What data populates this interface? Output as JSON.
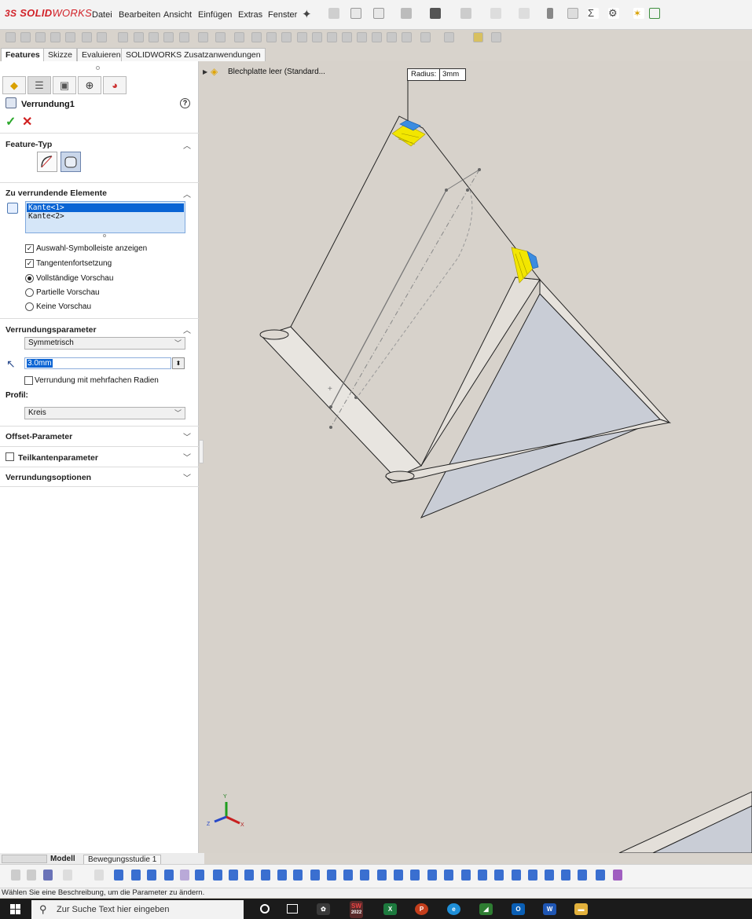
{
  "app": {
    "logo_main": "SOLID",
    "logo_thin": "WORKS",
    "logo_prefix": "3S"
  },
  "menu": [
    "Datei",
    "Bearbeiten",
    "Ansicht",
    "Einfügen",
    "Extras",
    "Fenster"
  ],
  "command_tabs": [
    "Features",
    "Skizze",
    "Evaluieren",
    "SOLIDWORKS Zusatzanwendungen"
  ],
  "property_manager": {
    "title": "Verrundung1",
    "help": "?",
    "ok": "✓",
    "cancel": "✕",
    "sections": {
      "feature_type": "Feature-Typ",
      "items_to_fillet": "Zu verrundende Elemente",
      "fillet_params": "Verrundungsparameter",
      "offset_params": "Offset-Parameter",
      "partial_edge_params": "Teilkantenparameter",
      "fillet_options": "Verrundungsoptionen"
    },
    "edges": [
      "Kante<1>",
      "Kante<2>"
    ],
    "options": {
      "show_selection_toolbar": "Auswahl-Symbolleiste anzeigen",
      "tangent_propagation": "Tangentenfortsetzung",
      "full_preview": "Vollständige Vorschau",
      "partial_preview": "Partielle Vorschau",
      "no_preview": "Keine Vorschau",
      "multiple_radius": "Verrundung mit mehrfachen Radien"
    },
    "fillet_method": "Symmetrisch",
    "radius_value": "3.0mm",
    "profile_label": "Profil:",
    "profile_value": "Kreis"
  },
  "viewport": {
    "tree_label": "Blechplatte leer (Standard...",
    "callout_label": "Radius:",
    "callout_value": "3mm",
    "triad_y": "Y",
    "triad_x": "X",
    "triad_z": "Z"
  },
  "bottom_tabs": [
    "Modell",
    "Bewegungsstudie 1"
  ],
  "status_text": "Wählen Sie eine Beschreibung, um die Parameter zu ändern.",
  "taskbar": {
    "search_placeholder": "Zur Suche Text hier eingeben",
    "sw_badge": "SW",
    "sw_year": "2022"
  },
  "colors": {
    "brand_red": "#d2232a",
    "selection_blue": "#0a64d4",
    "fillet_preview_yellow": "#f2e600",
    "model_face": "#c9cdd6",
    "sheet_edge": "#e6e2dc"
  }
}
